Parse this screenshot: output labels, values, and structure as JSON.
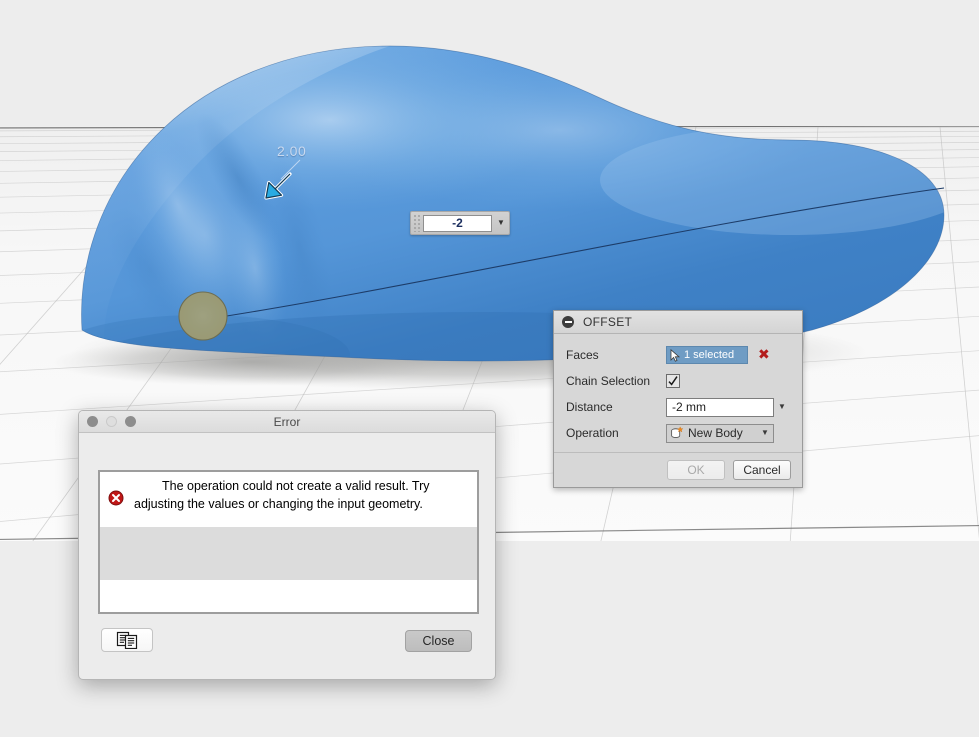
{
  "viewport": {
    "name": "3d-viewport",
    "background_color": "#ededed",
    "model_color": "#5b9bd9",
    "ground_color": "#f4f4f4",
    "manipulator": {
      "value_label": "2.00",
      "arrow_color": "#29abe2",
      "arrow_direction": "down-left"
    },
    "inline_distance_field": {
      "value": "-2",
      "dropdown_glyph": "▼"
    }
  },
  "offset_panel": {
    "title": "OFFSET",
    "collapse_icon": "minus-circle-icon",
    "rows": [
      {
        "label": "Faces",
        "value": "1 selected",
        "clear": "✖"
      },
      {
        "label": "Chain Selection",
        "value": ""
      },
      {
        "label": "Distance",
        "value": "-2 mm"
      },
      {
        "label": "Operation",
        "value": "New Body"
      }
    ],
    "faces_label": "Faces",
    "faces_value": "1 selected",
    "faces_clear": "✖",
    "chain_label": "Chain Selection",
    "chain_checked": true,
    "distance_label": "Distance",
    "distance_value": "-2 mm",
    "operation_label": "Operation",
    "operation_value": "New Body",
    "ok_label": "OK",
    "ok_enabled": false,
    "cancel_label": "Cancel",
    "accent_selection_color": "#6f9cc4",
    "clear_color": "#b31c1c"
  },
  "error_dialog": {
    "title": "Error",
    "traffic_lights": [
      "close",
      "minimize",
      "zoom"
    ],
    "message": "The operation could not create a valid result. Try adjusting the values or changing the input geometry.",
    "error_icon": "error-circle-x-icon",
    "copy_icon": "copy-to-clipboard-icon",
    "close_label": "Close",
    "error_icon_color": "#c01717"
  }
}
